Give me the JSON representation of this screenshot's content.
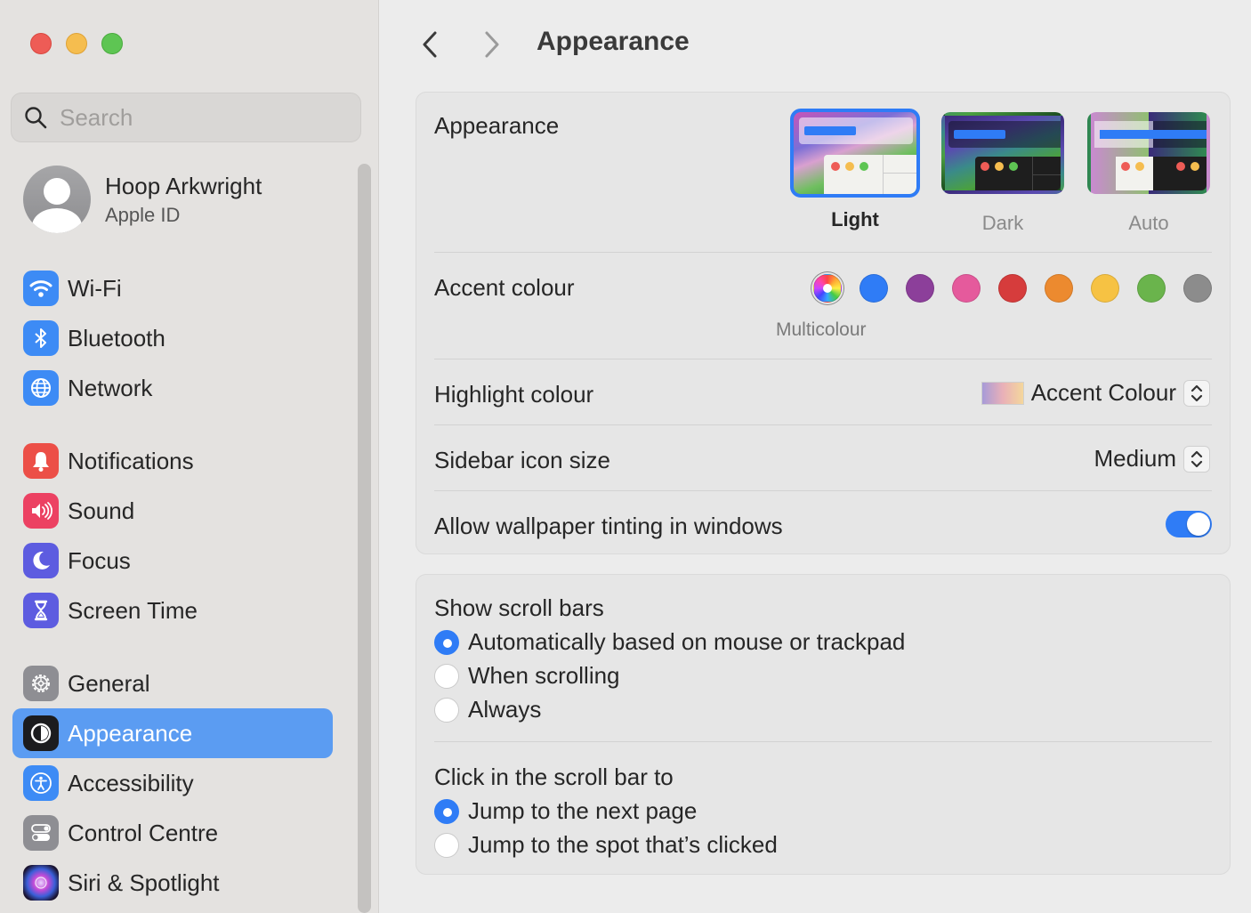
{
  "window": {
    "traffic_lights": [
      "close",
      "minimize",
      "zoom"
    ]
  },
  "sidebar": {
    "search": {
      "placeholder": "Search",
      "value": "",
      "icon": "search-icon"
    },
    "profile": {
      "name": "Hoop Arkwright",
      "subtitle": "Apple ID",
      "icon": "avatar-icon"
    },
    "items": [
      {
        "label": "Wi-Fi",
        "icon": "wifi-icon",
        "color": "#3d8bf5",
        "active": false
      },
      {
        "label": "Bluetooth",
        "icon": "bluetooth-icon",
        "color": "#3d8bf5",
        "active": false
      },
      {
        "label": "Network",
        "icon": "globe-icon",
        "color": "#3d8bf5",
        "active": false
      },
      {
        "label": "Notifications",
        "icon": "bell-icon",
        "color": "#ec4f47",
        "active": false
      },
      {
        "label": "Sound",
        "icon": "speaker-icon",
        "color": "#ec4162",
        "active": false
      },
      {
        "label": "Focus",
        "icon": "moon-icon",
        "color": "#5d5ce0",
        "active": false
      },
      {
        "label": "Screen Time",
        "icon": "hourglass-icon",
        "color": "#5d5ce0",
        "active": false
      },
      {
        "label": "General",
        "icon": "gear-icon",
        "color": "#8e8e93",
        "active": false
      },
      {
        "label": "Appearance",
        "icon": "appearance-icon",
        "color": "#1c1c1e",
        "active": true
      },
      {
        "label": "Accessibility",
        "icon": "accessibility-icon",
        "color": "#3d8bf5",
        "active": false
      },
      {
        "label": "Control Centre",
        "icon": "toggles-icon",
        "color": "#8e8e93",
        "active": false
      },
      {
        "label": "Siri & Spotlight",
        "icon": "siri-icon",
        "color": "#3a2f5c",
        "active": false
      }
    ]
  },
  "main": {
    "title": "Appearance",
    "back_icon": "chevron-left-icon",
    "forward_icon": "chevron-right-icon",
    "appearance_section": {
      "label": "Appearance",
      "options": [
        {
          "label": "Light",
          "selected": true
        },
        {
          "label": "Dark",
          "selected": false
        },
        {
          "label": "Auto",
          "selected": false
        }
      ]
    },
    "accent_colour": {
      "label": "Accent colour",
      "selected_caption": "Multicolour",
      "swatches": [
        {
          "name": "Multicolour",
          "color": "multicolour",
          "selected": true
        },
        {
          "name": "Blue",
          "color": "#2f7cf6"
        },
        {
          "name": "Purple",
          "color": "#8c3f9a"
        },
        {
          "name": "Pink",
          "color": "#e55a9c"
        },
        {
          "name": "Red",
          "color": "#d63c3c"
        },
        {
          "name": "Orange",
          "color": "#ec8a2f"
        },
        {
          "name": "Yellow",
          "color": "#f6c243"
        },
        {
          "name": "Green",
          "color": "#6ab44c"
        },
        {
          "name": "Graphite",
          "color": "#8c8c8c"
        }
      ]
    },
    "highlight_colour": {
      "label": "Highlight colour",
      "value": "Accent Colour"
    },
    "sidebar_icon_size": {
      "label": "Sidebar icon size",
      "value": "Medium"
    },
    "wallpaper_tinting": {
      "label": "Allow wallpaper tinting in windows",
      "enabled": true
    },
    "scroll_bars": {
      "title": "Show scroll bars",
      "options": [
        {
          "label": "Automatically based on mouse or trackpad",
          "checked": true
        },
        {
          "label": "When scrolling",
          "checked": false
        },
        {
          "label": "Always",
          "checked": false
        }
      ]
    },
    "click_scroll_bar": {
      "title": "Click in the scroll bar to",
      "options": [
        {
          "label": "Jump to the next page",
          "checked": true
        },
        {
          "label": "Jump to the spot that’s clicked",
          "checked": false
        }
      ]
    }
  }
}
